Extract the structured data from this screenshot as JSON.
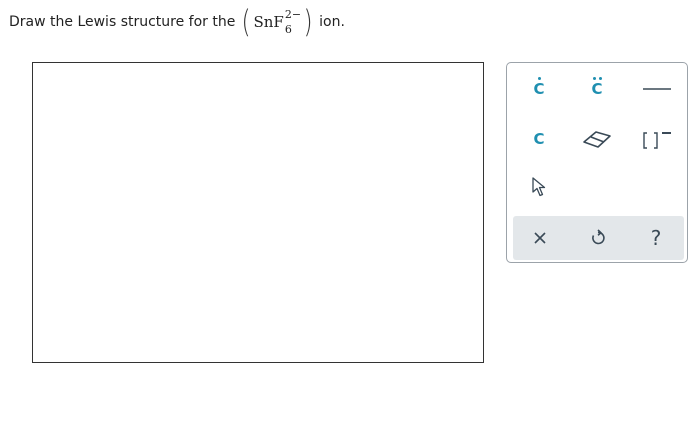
{
  "question": {
    "prefix": "Draw the Lewis structure for the",
    "element_text": "SnF",
    "charge": "2−",
    "subscript": "6",
    "suffix": "ion."
  },
  "toolbox": {
    "atom_symbol": "C",
    "bracket_charge": "−",
    "tools": [
      "radical-atom-tool",
      "lone-pair-atom-tool",
      "single-bond-tool",
      "atom-tool",
      "eraser-tool",
      "bracket-charge-tool",
      "select-tool"
    ],
    "actions": [
      "clear",
      "undo",
      "help"
    ],
    "help_label": "?",
    "accent_color": "#1f8fb0",
    "icon_color": "#3a4a57"
  }
}
